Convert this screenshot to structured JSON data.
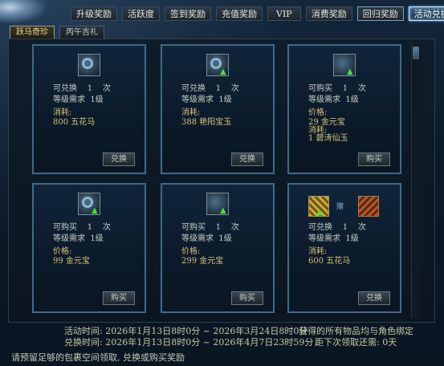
{
  "top_tabs": [
    {
      "label": "升级奖励",
      "active": false
    },
    {
      "label": "活跃度",
      "active": false
    },
    {
      "label": "签到奖励",
      "active": false
    },
    {
      "label": "充值奖励",
      "active": false
    },
    {
      "label": "VIP",
      "active": false
    },
    {
      "label": "消费奖励",
      "active": false
    },
    {
      "label": "回归奖励",
      "active": false
    },
    {
      "label": "活动兑换",
      "active": true
    }
  ],
  "sub_tabs": [
    {
      "label": "跃马奇珍",
      "active": true
    },
    {
      "label": "丙午吉礼",
      "active": false
    }
  ],
  "cards": [
    {
      "row1_label": "可兑换",
      "row1_count": "1",
      "row1_unit": "次",
      "level_label": "等级需求",
      "level": "1级",
      "cost_label": "消耗:",
      "cost_lines": [
        "800 五花马"
      ],
      "button": "兑换",
      "icon": "ring-icon",
      "arrow": false
    },
    {
      "row1_label": "可兑换",
      "row1_count": "1",
      "row1_unit": "次",
      "level_label": "等级需求",
      "level": "1级",
      "cost_label": "消耗:",
      "cost_lines": [
        "388 艳阳宝玉"
      ],
      "button": "兑换",
      "icon": "ring-icon",
      "arrow": true
    },
    {
      "row1_label": "可购买",
      "row1_count": "1",
      "row1_unit": "次",
      "level_label": "等级需求",
      "level": "1级",
      "cost_label": "价格:",
      "cost_lines": [
        "29 金元宝",
        "消耗:",
        "1 碧涛仙玉"
      ],
      "button": "购买",
      "icon": "bracelet-icon",
      "arrow": true
    },
    {
      "row1_label": "可购买",
      "row1_count": "1",
      "row1_unit": "次",
      "level_label": "等级需求",
      "level": "1级",
      "cost_label": "价格:",
      "cost_lines": [
        "99 金元宝"
      ],
      "button": "购买",
      "icon": "ring-icon",
      "arrow": true
    },
    {
      "row1_label": "可购买",
      "row1_count": "1",
      "row1_unit": "次",
      "level_label": "等级需求",
      "level": "1级",
      "cost_label": "价格:",
      "cost_lines": [
        "299 金元宝"
      ],
      "button": "购买",
      "icon": "bow-icon",
      "arrow": true
    },
    {
      "row1_label": "可兑换",
      "row1_count": "1",
      "row1_unit": "次",
      "level_label": "等级需求",
      "level": "1级",
      "cost_label": "消耗:",
      "cost_lines": [
        "600 五花马"
      ],
      "button": "兑换",
      "icon": "gift-pair-icon",
      "arrow": true,
      "gift_mark": "赠"
    }
  ],
  "footer": {
    "activity_time": "活动时间: 2026年1月13日8时0分 ~ 2026年3月24日8时0分",
    "exchange_time": "兑换时间: 2026年1月13日8时0分 ~ 2026年4月7日23时59分",
    "bind_note": "获得的所有物品均与角色绑定",
    "next_claim": "距下次领取还需: 0天"
  },
  "hint": "请预留足够的包裹空间领取, 兑换或购买奖励"
}
